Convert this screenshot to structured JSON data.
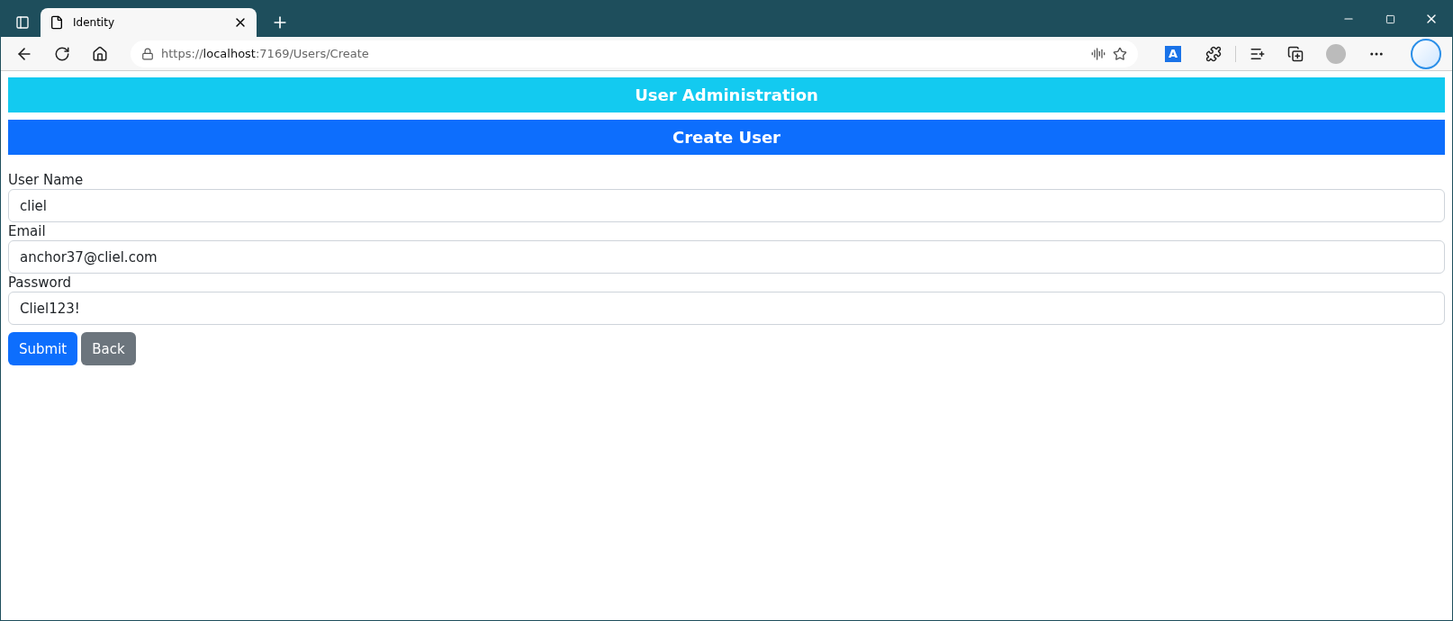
{
  "browser": {
    "tabs": [
      {
        "title": "Identity",
        "selected": true
      }
    ],
    "address": {
      "scheme": "https://",
      "host": "localhost",
      "path": ":7169/Users/Create"
    },
    "extension_label": "A"
  },
  "page": {
    "banners": [
      {
        "text": "User Administration",
        "kind": "info"
      },
      {
        "text": "Create User",
        "kind": "primary"
      }
    ],
    "fields": [
      {
        "label": "User Name",
        "value": "cliel"
      },
      {
        "label": "Email",
        "value": "anchor37@cliel.com"
      },
      {
        "label": "Password",
        "value": "Cliel123!"
      }
    ],
    "buttons": [
      {
        "label": "Submit",
        "kind": "primary"
      },
      {
        "label": "Back",
        "kind": "secondary"
      }
    ]
  }
}
